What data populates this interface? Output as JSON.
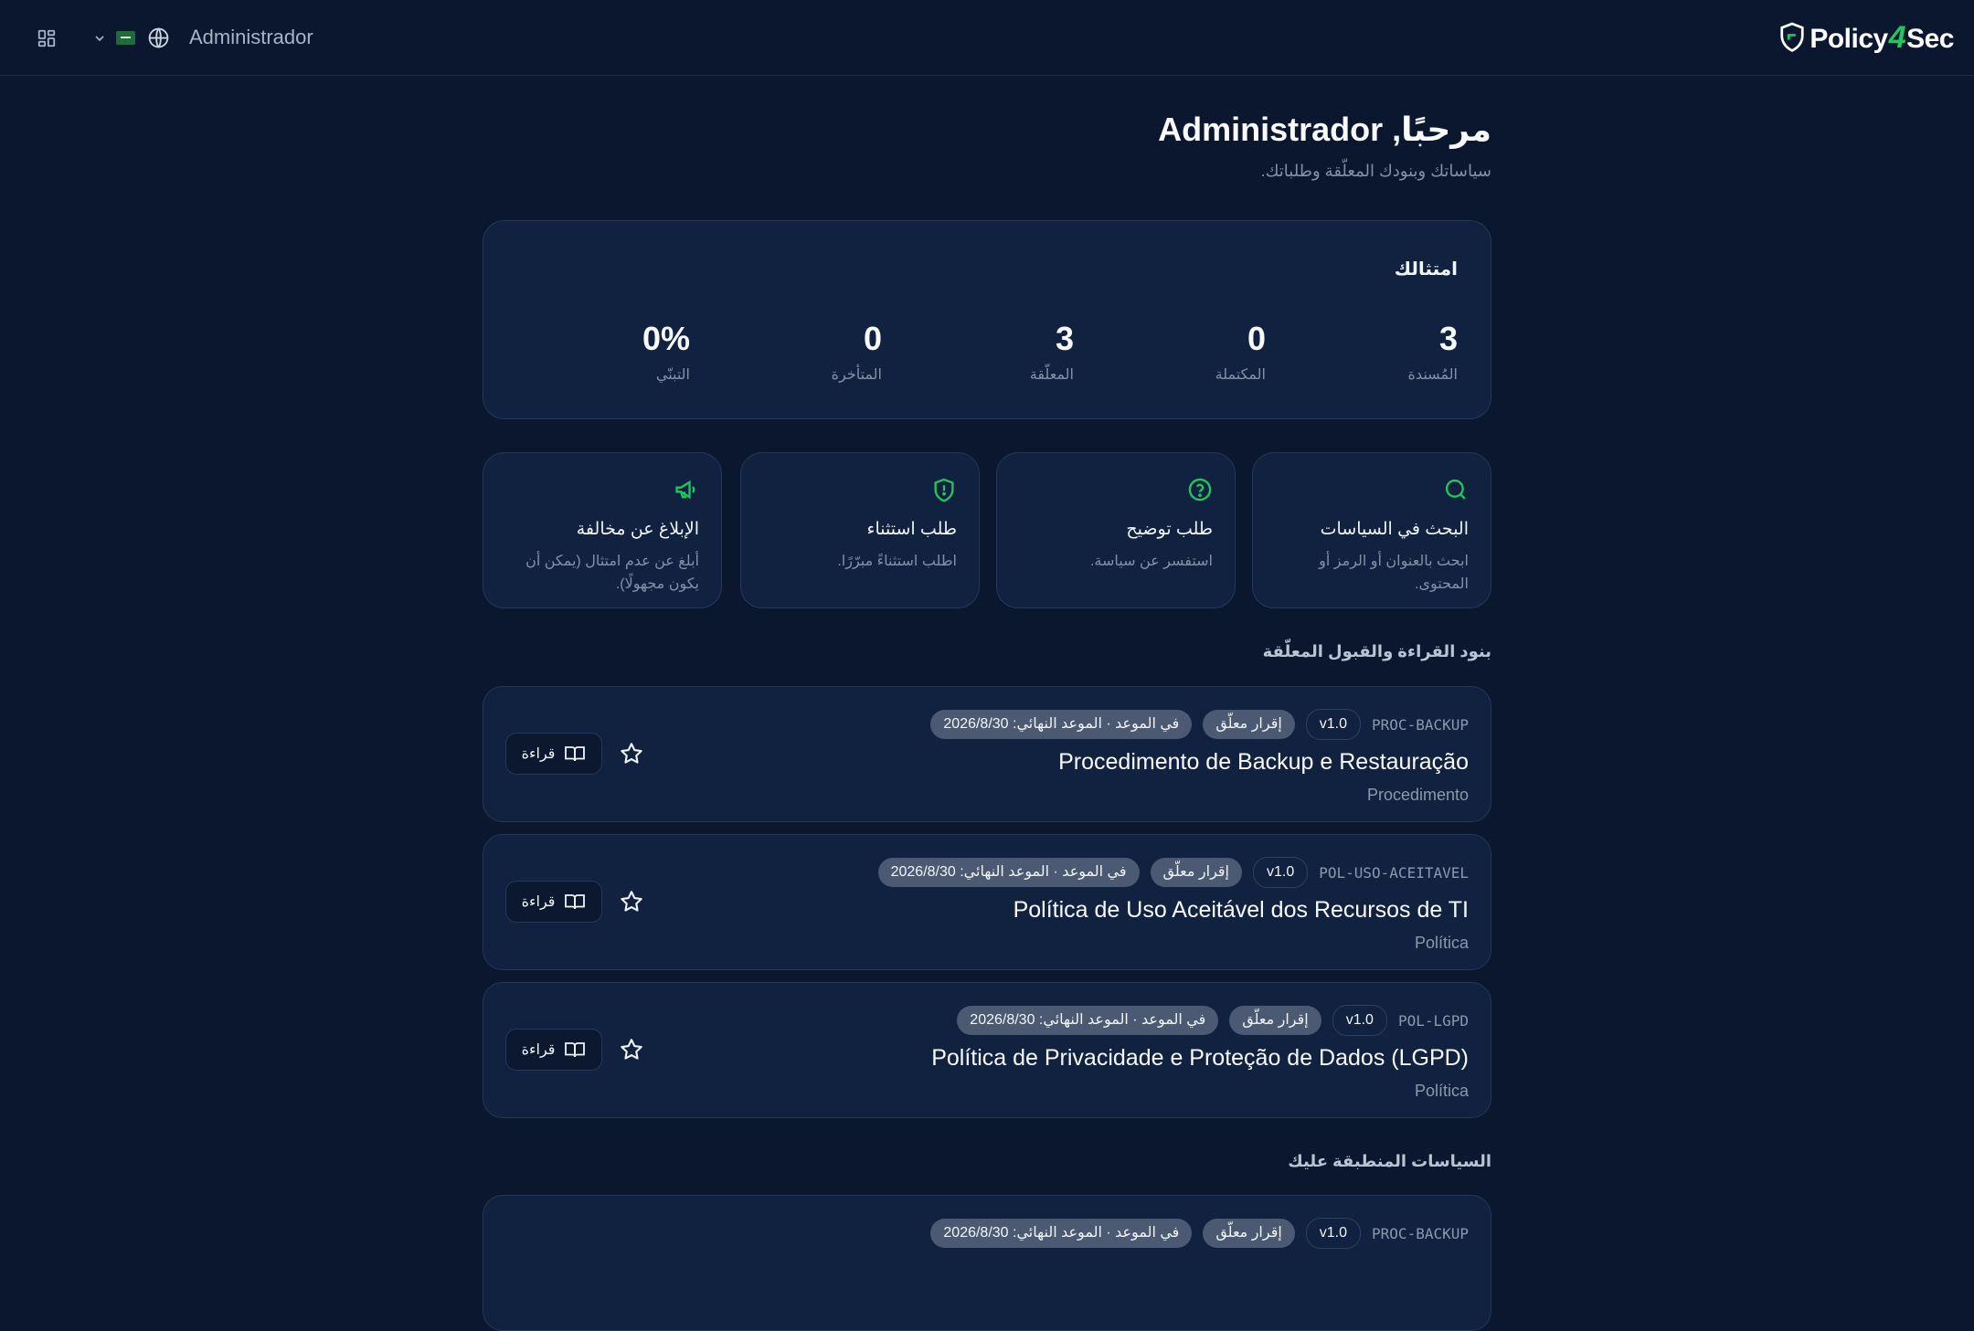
{
  "header": {
    "user_name": "Administrador",
    "logo": {
      "part1": "Policy",
      "part2": "4",
      "part3": "Sec"
    }
  },
  "page": {
    "title": "مرحبًا, Administrador",
    "subtitle": "سياساتك وبنودك المعلّقة وطلباتك."
  },
  "compliance": {
    "title": "امتثالك",
    "stats": [
      {
        "label": "المُسندة",
        "value": "3"
      },
      {
        "label": "المكتملة",
        "value": "0"
      },
      {
        "label": "المعلّقة",
        "value": "3"
      },
      {
        "label": "المتأخرة",
        "value": "0"
      },
      {
        "label": "التبنّي",
        "value": "0%"
      }
    ]
  },
  "actions": [
    {
      "title": "البحث في السياسات",
      "desc": "ابحث بالعنوان أو الرمز أو المحتوى.",
      "icon": "search-icon"
    },
    {
      "title": "طلب توضيح",
      "desc": "استفسر عن سياسة.",
      "icon": "question-circle-icon"
    },
    {
      "title": "طلب استثناء",
      "desc": "اطلب استثناءً مبرّرًا.",
      "icon": "shield-alert-icon"
    },
    {
      "title": "الإبلاغ عن مخالفة",
      "desc": "أبلغ عن عدم امتثال (يمكن أن يكون مجهولًا).",
      "icon": "megaphone-icon"
    }
  ],
  "pending_section": {
    "title": "بنود القراءة والقبول المعلّقة"
  },
  "pending_items": [
    {
      "code": "PROC-BACKUP",
      "version": "v1.0",
      "status": "إقرار معلّق",
      "due": "في الموعد · الموعد النهائي: 2026/8/30",
      "title": "Procedimento de Backup e Restauração",
      "type": "Procedimento",
      "read_label": "قراءة"
    },
    {
      "code": "POL-USO-ACEITAVEL",
      "version": "v1.0",
      "status": "إقرار معلّق",
      "due": "في الموعد · الموعد النهائي: 2026/8/30",
      "title": "Política de Uso Aceitável dos Recursos de TI",
      "type": "Política",
      "read_label": "قراءة"
    },
    {
      "code": "POL-LGPD",
      "version": "v1.0",
      "status": "إقرار معلّق",
      "due": "في الموعد · الموعد النهائي: 2026/8/30",
      "title": "Política de Privacidade e Proteção de Dados (LGPD)",
      "type": "Política",
      "read_label": "قراءة"
    }
  ],
  "applicable_section": {
    "title": "السياسات المنطبقة عليك"
  },
  "applicable_items": [
    {
      "code": "PROC-BACKUP",
      "version": "v1.0",
      "status": "إقرار معلّق",
      "due": "في الموعد · الموعد النهائي: 2026/8/30"
    }
  ],
  "colors": {
    "accent": "#22c55e",
    "background": "#0a172f",
    "card": "#112240"
  }
}
